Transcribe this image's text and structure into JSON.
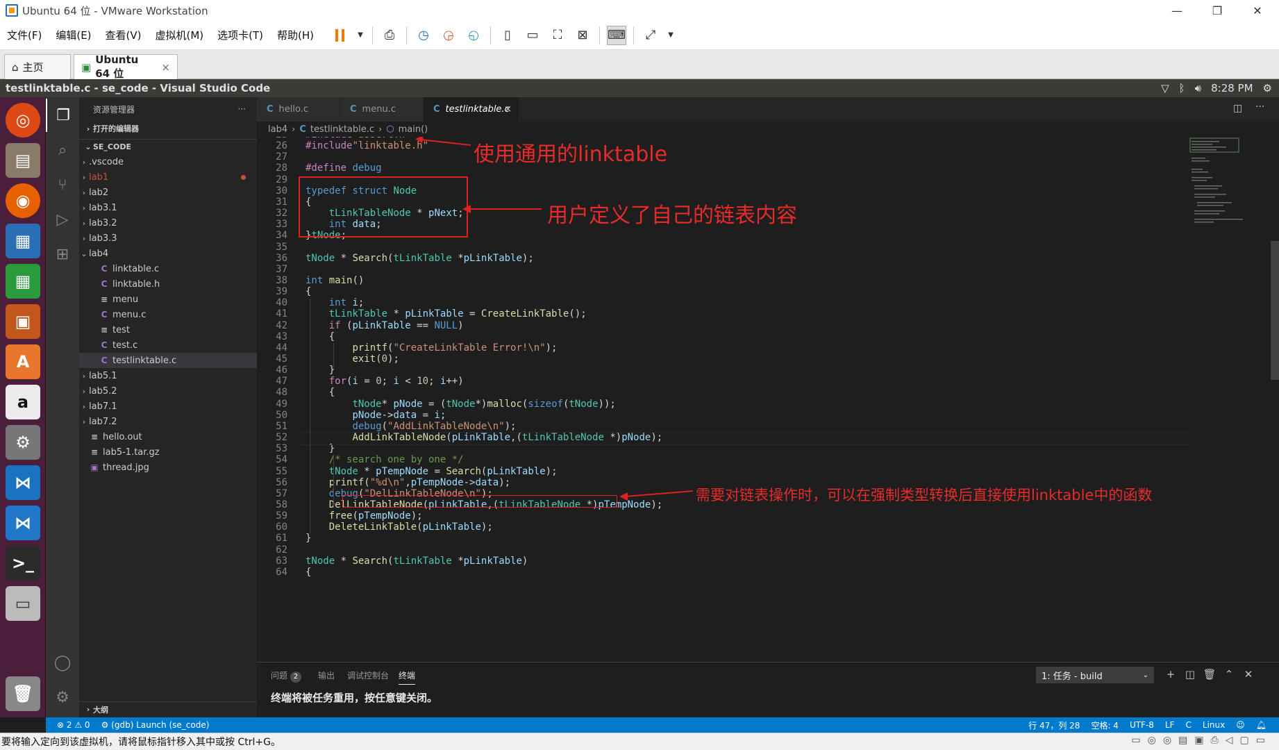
{
  "vmware": {
    "title": "Ubuntu 64 位 - VMware Workstation",
    "menu": [
      "文件(F)",
      "编辑(E)",
      "查看(V)",
      "虚拟机(M)",
      "选项卡(T)",
      "帮助(H)"
    ],
    "tabs": [
      {
        "label": "主页",
        "icon": "home-icon"
      },
      {
        "label": "Ubuntu 64 位",
        "icon": "vm-icon",
        "close": "×"
      }
    ],
    "status_message": "要将输入定向到该虚拟机，请将鼠标指针移入其中或按 Ctrl+G。"
  },
  "ubuntu_panel": {
    "window_title": "testlinktable.c - se_code - Visual Studio Code",
    "clock": "8:28 PM"
  },
  "explorer": {
    "header": "资源管理器",
    "more": "···",
    "open_editors": "打开的编辑器",
    "root": "SE_CODE",
    "outline": "大纲",
    "items": [
      {
        "label": ".vscode",
        "type": "folder",
        "depth": 1
      },
      {
        "label": "lab1",
        "type": "folder",
        "depth": 1,
        "modified": true
      },
      {
        "label": "lab2",
        "type": "folder",
        "depth": 1
      },
      {
        "label": "lab3.1",
        "type": "folder",
        "depth": 1
      },
      {
        "label": "lab3.2",
        "type": "folder",
        "depth": 1
      },
      {
        "label": "lab3.3",
        "type": "folder",
        "depth": 1
      },
      {
        "label": "lab4",
        "type": "folder-open",
        "depth": 1
      },
      {
        "label": "linktable.c",
        "type": "c",
        "depth": 2
      },
      {
        "label": "linktable.h",
        "type": "h",
        "depth": 2
      },
      {
        "label": "menu",
        "type": "txt",
        "depth": 2
      },
      {
        "label": "menu.c",
        "type": "c",
        "depth": 2
      },
      {
        "label": "test",
        "type": "txt",
        "depth": 2
      },
      {
        "label": "test.c",
        "type": "c",
        "depth": 2
      },
      {
        "label": "testlinktable.c",
        "type": "c",
        "depth": 2,
        "selected": true
      },
      {
        "label": "lab5.1",
        "type": "folder",
        "depth": 1
      },
      {
        "label": "lab5.2",
        "type": "folder",
        "depth": 1
      },
      {
        "label": "lab7.1",
        "type": "folder",
        "depth": 1
      },
      {
        "label": "lab7.2",
        "type": "folder",
        "depth": 1
      },
      {
        "label": "hello.out",
        "type": "txt",
        "depth": 1
      },
      {
        "label": "lab5-1.tar.gz",
        "type": "txt",
        "depth": 1
      },
      {
        "label": "thread.jpg",
        "type": "img",
        "depth": 1
      }
    ]
  },
  "editor": {
    "tabs": [
      {
        "label": "hello.c",
        "icon": "C"
      },
      {
        "label": "menu.c",
        "icon": "C"
      },
      {
        "label": "testlinktable.c",
        "icon": "C",
        "active": true,
        "close": "×"
      }
    ],
    "breadcrumb": [
      "lab4",
      "testlinktable.c",
      "main()"
    ],
    "first_line": 25,
    "lines": [
      [
        [
          "pp",
          "#include"
        ],
        [
          "st",
          "<assert.h>"
        ]
      ],
      [
        [
          "pp",
          "#include"
        ],
        [
          "st",
          "\"linktable.h\""
        ]
      ],
      [],
      [
        [
          "pp",
          "#define"
        ],
        [
          "",
          " "
        ],
        [
          "kw",
          "debug"
        ]
      ],
      [],
      [
        [
          "kw",
          "typedef"
        ],
        [
          "",
          " "
        ],
        [
          "kw",
          "struct"
        ],
        [
          "",
          " "
        ],
        [
          "ty",
          "Node"
        ]
      ],
      [
        [
          "",
          "{"
        ]
      ],
      [
        [
          "",
          "    "
        ],
        [
          "ty",
          "tLinkTableNode"
        ],
        [
          "",
          " * "
        ],
        [
          "va",
          "pNext"
        ],
        [
          "",
          ";"
        ]
      ],
      [
        [
          "",
          "    "
        ],
        [
          "kw",
          "int"
        ],
        [
          "",
          " "
        ],
        [
          "va",
          "data"
        ],
        [
          "",
          ";"
        ]
      ],
      [
        [
          "",
          "}"
        ],
        [
          "ty",
          "tNode"
        ],
        [
          "",
          ";"
        ]
      ],
      [],
      [
        [
          "ty",
          "tNode"
        ],
        [
          "",
          " * "
        ],
        [
          "fn",
          "Search"
        ],
        [
          "",
          "("
        ],
        [
          "ty",
          "tLinkTable"
        ],
        [
          "",
          " *"
        ],
        [
          "va",
          "pLinkTable"
        ],
        [
          "",
          ");"
        ]
      ],
      [],
      [
        [
          "kw",
          "int"
        ],
        [
          "",
          " "
        ],
        [
          "fn",
          "main"
        ],
        [
          "",
          "()"
        ]
      ],
      [
        [
          "",
          "{"
        ]
      ],
      [
        [
          "",
          "    "
        ],
        [
          "kw",
          "int"
        ],
        [
          "",
          " "
        ],
        [
          "va",
          "i"
        ],
        [
          "",
          ";"
        ]
      ],
      [
        [
          "",
          "    "
        ],
        [
          "ty",
          "tLinkTable"
        ],
        [
          "",
          " * "
        ],
        [
          "va",
          "pLinkTable"
        ],
        [
          "",
          " = "
        ],
        [
          "fn",
          "CreateLinkTable"
        ],
        [
          "",
          "();"
        ]
      ],
      [
        [
          "",
          "    "
        ],
        [
          "pp",
          "if"
        ],
        [
          "",
          " ("
        ],
        [
          "va",
          "pLinkTable"
        ],
        [
          "",
          " == "
        ],
        [
          "kw",
          "NULL"
        ],
        [
          "",
          ")"
        ]
      ],
      [
        [
          "",
          "    {"
        ]
      ],
      [
        [
          "",
          "        "
        ],
        [
          "fn",
          "printf"
        ],
        [
          "",
          "("
        ],
        [
          "st",
          "\"CreateLinkTable Error!\\n\""
        ],
        [
          "",
          ");"
        ]
      ],
      [
        [
          "",
          "        "
        ],
        [
          "fn",
          "exit"
        ],
        [
          "",
          "("
        ],
        [
          "nm",
          "0"
        ],
        [
          "",
          ");"
        ]
      ],
      [
        [
          "",
          "    }"
        ]
      ],
      [
        [
          "",
          "    "
        ],
        [
          "pp",
          "for"
        ],
        [
          "",
          "("
        ],
        [
          "va",
          "i"
        ],
        [
          "",
          " = "
        ],
        [
          "nm",
          "0"
        ],
        [
          "",
          "; "
        ],
        [
          "va",
          "i"
        ],
        [
          "",
          " < "
        ],
        [
          "nm",
          "10"
        ],
        [
          "",
          "; "
        ],
        [
          "va",
          "i"
        ],
        [
          "",
          "++)"
        ]
      ],
      [
        [
          "",
          "    {"
        ]
      ],
      [
        [
          "",
          "        "
        ],
        [
          "ty",
          "tNode"
        ],
        [
          "",
          "* "
        ],
        [
          "va",
          "pNode"
        ],
        [
          "",
          " = ("
        ],
        [
          "ty",
          "tNode"
        ],
        [
          "",
          "*)"
        ],
        [
          "fn",
          "malloc"
        ],
        [
          "",
          "("
        ],
        [
          "kw",
          "sizeof"
        ],
        [
          "",
          "("
        ],
        [
          "ty",
          "tNode"
        ],
        [
          "",
          "));"
        ]
      ],
      [
        [
          "",
          "        "
        ],
        [
          "va",
          "pNode"
        ],
        [
          "",
          "->"
        ],
        [
          "va",
          "data"
        ],
        [
          "",
          " = "
        ],
        [
          "va",
          "i"
        ],
        [
          "",
          ";"
        ]
      ],
      [
        [
          "",
          "        "
        ],
        [
          "kw",
          "debug"
        ],
        [
          "",
          "("
        ],
        [
          "st",
          "\"AddLinkTableNode\\n\""
        ],
        [
          "",
          ");"
        ]
      ],
      [
        [
          "",
          "        "
        ],
        [
          "fn",
          "AddLinkTableNode"
        ],
        [
          "",
          "("
        ],
        [
          "va",
          "pLinkTable"
        ],
        [
          "",
          ",("
        ],
        [
          "ty",
          "tLinkTableNode"
        ],
        [
          "",
          " *)"
        ],
        [
          "va",
          "pNode"
        ],
        [
          "",
          ");"
        ]
      ],
      [
        [
          "",
          "    }"
        ]
      ],
      [
        [
          "",
          "    "
        ],
        [
          "cm",
          "/* search one by one */"
        ]
      ],
      [
        [
          "",
          "    "
        ],
        [
          "ty",
          "tNode"
        ],
        [
          "",
          " * "
        ],
        [
          "va",
          "pTempNode"
        ],
        [
          "",
          " = "
        ],
        [
          "fn",
          "Search"
        ],
        [
          "",
          "("
        ],
        [
          "va",
          "pLinkTable"
        ],
        [
          "",
          ");"
        ]
      ],
      [
        [
          "",
          "    "
        ],
        [
          "fn",
          "printf"
        ],
        [
          "",
          "("
        ],
        [
          "st",
          "\"%d\\n\""
        ],
        [
          "",
          ","
        ],
        [
          "va",
          "pTempNode"
        ],
        [
          "",
          "->"
        ],
        [
          "va",
          "data"
        ],
        [
          "",
          ");"
        ]
      ],
      [
        [
          "",
          "    "
        ],
        [
          "kw",
          "debug"
        ],
        [
          "",
          "("
        ],
        [
          "st",
          "\"DelLinkTableNode\\n\""
        ],
        [
          "",
          ");"
        ]
      ],
      [
        [
          "",
          "    "
        ],
        [
          "fn",
          "DelLinkTableNode"
        ],
        [
          "",
          "("
        ],
        [
          "va",
          "pLinkTable"
        ],
        [
          "",
          ",("
        ],
        [
          "ty",
          "tLinkTableNode"
        ],
        [
          "",
          " *)"
        ],
        [
          "va",
          "pTempNode"
        ],
        [
          "",
          ");"
        ]
      ],
      [
        [
          "",
          "    "
        ],
        [
          "fn",
          "free"
        ],
        [
          "",
          "("
        ],
        [
          "va",
          "pTempNode"
        ],
        [
          "",
          ");"
        ]
      ],
      [
        [
          "",
          "    "
        ],
        [
          "fn",
          "DeleteLinkTable"
        ],
        [
          "",
          "("
        ],
        [
          "va",
          "pLinkTable"
        ],
        [
          "",
          ");"
        ]
      ],
      [
        [
          "",
          "}"
        ]
      ],
      [],
      [
        [
          "ty",
          "tNode"
        ],
        [
          "",
          " * "
        ],
        [
          "fn",
          "Search"
        ],
        [
          "",
          "("
        ],
        [
          "ty",
          "tLinkTable"
        ],
        [
          "",
          " *"
        ],
        [
          "va",
          "pLinkTable"
        ],
        [
          "",
          ")"
        ]
      ],
      [
        [
          "",
          "{"
        ]
      ]
    ]
  },
  "annotations": [
    "使用通用的linktable",
    "用户定义了自己的链表内容",
    "需要对链表操作时，可以在强制类型转换后直接使用linktable中的函数"
  ],
  "panel": {
    "tabs": [
      {
        "label": "问题",
        "badge": "2"
      },
      {
        "label": "输出"
      },
      {
        "label": "调试控制台"
      },
      {
        "label": "终端",
        "active": true
      }
    ],
    "task_select": "1: 任务 - build",
    "terminal_message": "终端将被任务重用，按任意键关闭。"
  },
  "statusbar": {
    "errors": "⊗ 2",
    "warnings": "⚠ 0",
    "debug": "(gdb) Launch (se_code)",
    "position": "行 47，列 28",
    "spaces": "空格: 4",
    "encoding": "UTF-8",
    "eol": "LF",
    "language": "C",
    "os": "Linux"
  },
  "colors": {
    "accent": "#007acc",
    "annotation": "#e02020",
    "launcher": "#4b1f3c"
  }
}
